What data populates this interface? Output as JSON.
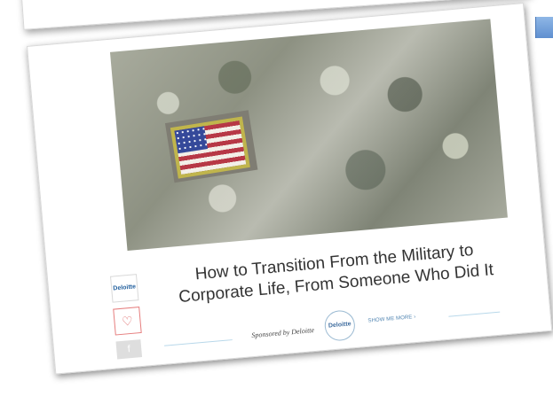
{
  "card": {
    "title_line_1": "How to Transition From the Military to",
    "title_line_2": "Corporate Life, From Someone Who Did It",
    "sponsor_label": "Sponsored by Deloitte",
    "brand_logo": "Deloitte",
    "badge_brand": "Deloitte",
    "show_more_label": "SHOW ME MORE ›",
    "heart_icon": "♡",
    "facebook_icon": "f"
  },
  "icons": {
    "logo": "deloitte-logo-icon",
    "heart": "heart-icon",
    "facebook": "facebook-icon",
    "arrow": "arrow-icon"
  },
  "colors": {
    "accent": "#5f8fd0",
    "text": "#333333",
    "link": "#4e83b0",
    "heart": "#de6a6a",
    "rule": "#b8d8ea"
  }
}
